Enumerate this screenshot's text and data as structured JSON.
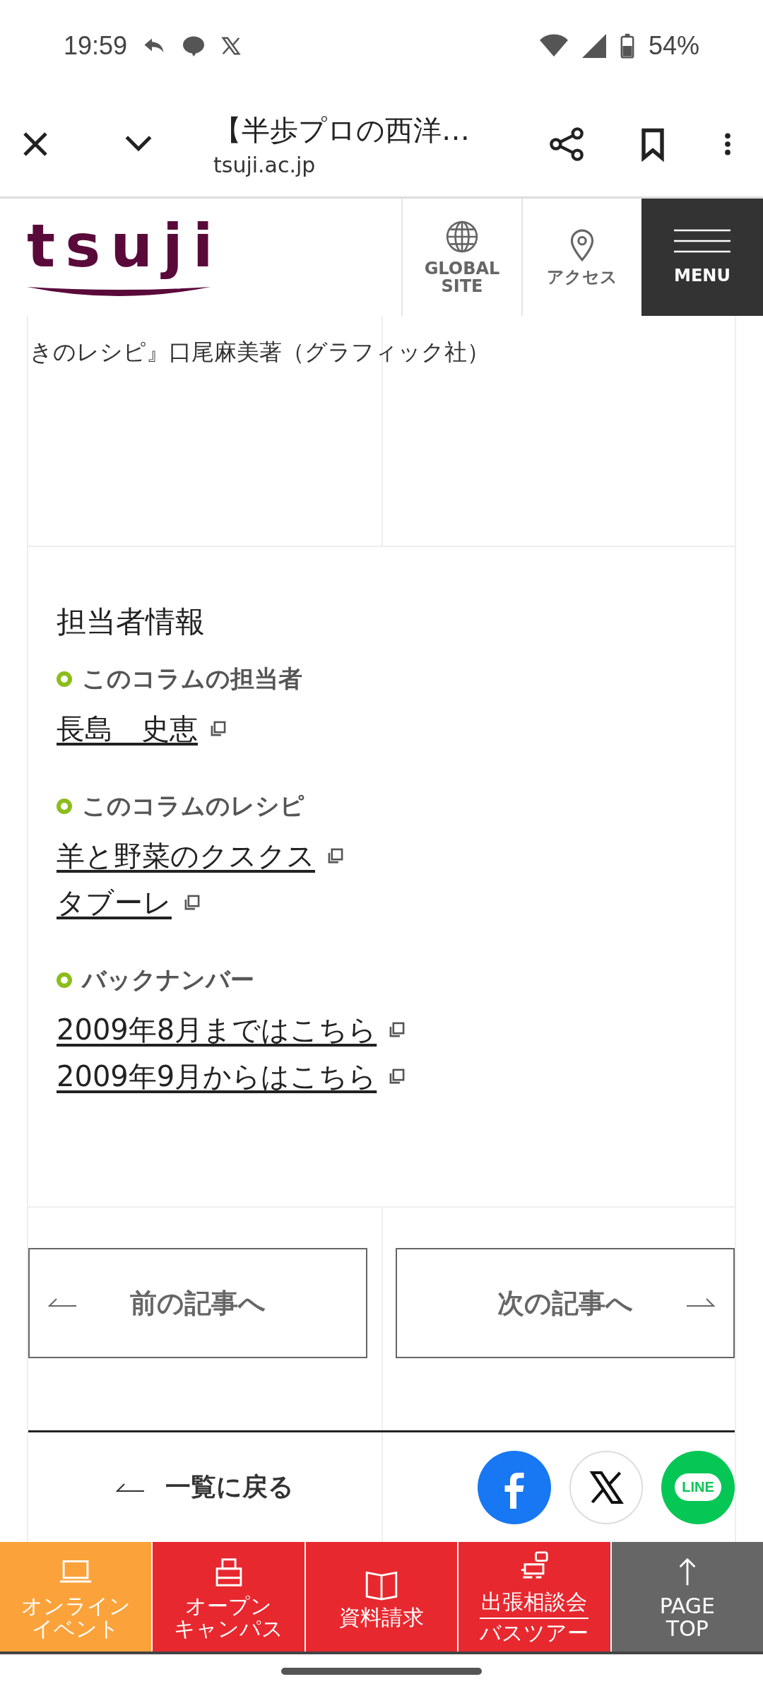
{
  "status_bar": {
    "time": "19:59",
    "battery": "54%"
  },
  "browser_bar": {
    "title": "【半歩プロの西洋…",
    "url": "tsuji.ac.jp"
  },
  "site_header": {
    "logo": "tsuji",
    "global": "GLOBAL\nSITE",
    "access": "アクセス",
    "menu": "MENU"
  },
  "book_text": {
    "line_2": "きのレシピ』口尾麻美著（グラフィック社）"
  },
  "staff_info": {
    "heading": "担当者情報",
    "groups": [
      {
        "title": "このコラムの担当者",
        "links": [
          "長島　史恵"
        ]
      },
      {
        "title": "このコラムのレシピ",
        "links": [
          "羊と野菜のクスクス",
          "タブーレ"
        ]
      },
      {
        "title": "バックナンバー",
        "links": [
          "2009年8月まではこちら",
          "2009年9月からはこちら"
        ]
      }
    ]
  },
  "article_nav": {
    "prev": "前の記事へ",
    "next": "次の記事へ"
  },
  "back_link": "一覧に戻る",
  "share": [
    {
      "kind": "facebook"
    },
    {
      "kind": "x"
    },
    {
      "kind": "line",
      "label": "LINE"
    }
  ],
  "footer_nav": [
    {
      "kind": "online",
      "label": "オンライン",
      "label_2": "イベント"
    },
    {
      "kind": "campus",
      "label": "オープン",
      "label_2": "キャンパス"
    },
    {
      "kind": "brochure",
      "label": "資料請求"
    },
    {
      "kind": "bus",
      "label": "出張相談会",
      "sublabel": "バスツアー"
    },
    {
      "kind": "top",
      "label": "PAGE\nTOP"
    }
  ]
}
